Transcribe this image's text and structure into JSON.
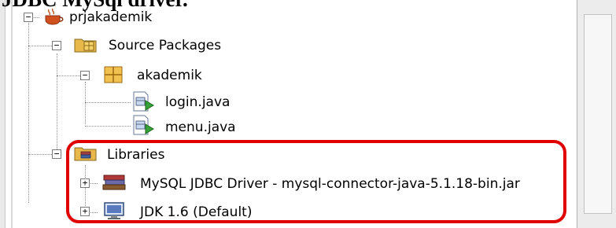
{
  "document": {
    "heading": "JDBC MySql driver."
  },
  "project_tree": {
    "project": {
      "label": "prjakademik",
      "icon": "coffee-cup-project-icon",
      "expanded": true
    },
    "source_packages": {
      "label": "Source Packages",
      "icon": "source-folder-icon",
      "expanded": true
    },
    "package": {
      "label": "akademik",
      "icon": "package-icon",
      "expanded": true
    },
    "files": [
      {
        "label": "login.java",
        "icon": "java-form-file-icon"
      },
      {
        "label": "menu.java",
        "icon": "java-form-file-icon"
      }
    ],
    "libraries": {
      "label": "Libraries",
      "icon": "library-folder-icon",
      "expanded": true
    },
    "library_items": [
      {
        "label": "MySQL JDBC Driver - mysql-connector-java-5.1.18-bin.jar",
        "icon": "books-library-icon",
        "expanded": false
      },
      {
        "label": "JDK 1.6 (Default)",
        "icon": "jdk-monitor-icon",
        "expanded": false
      }
    ],
    "toggle_expanded": "−",
    "toggle_collapsed": "+"
  },
  "colors": {
    "highlight": "#e00000",
    "folder": "#e8b84a",
    "package": "#e3a93a"
  }
}
